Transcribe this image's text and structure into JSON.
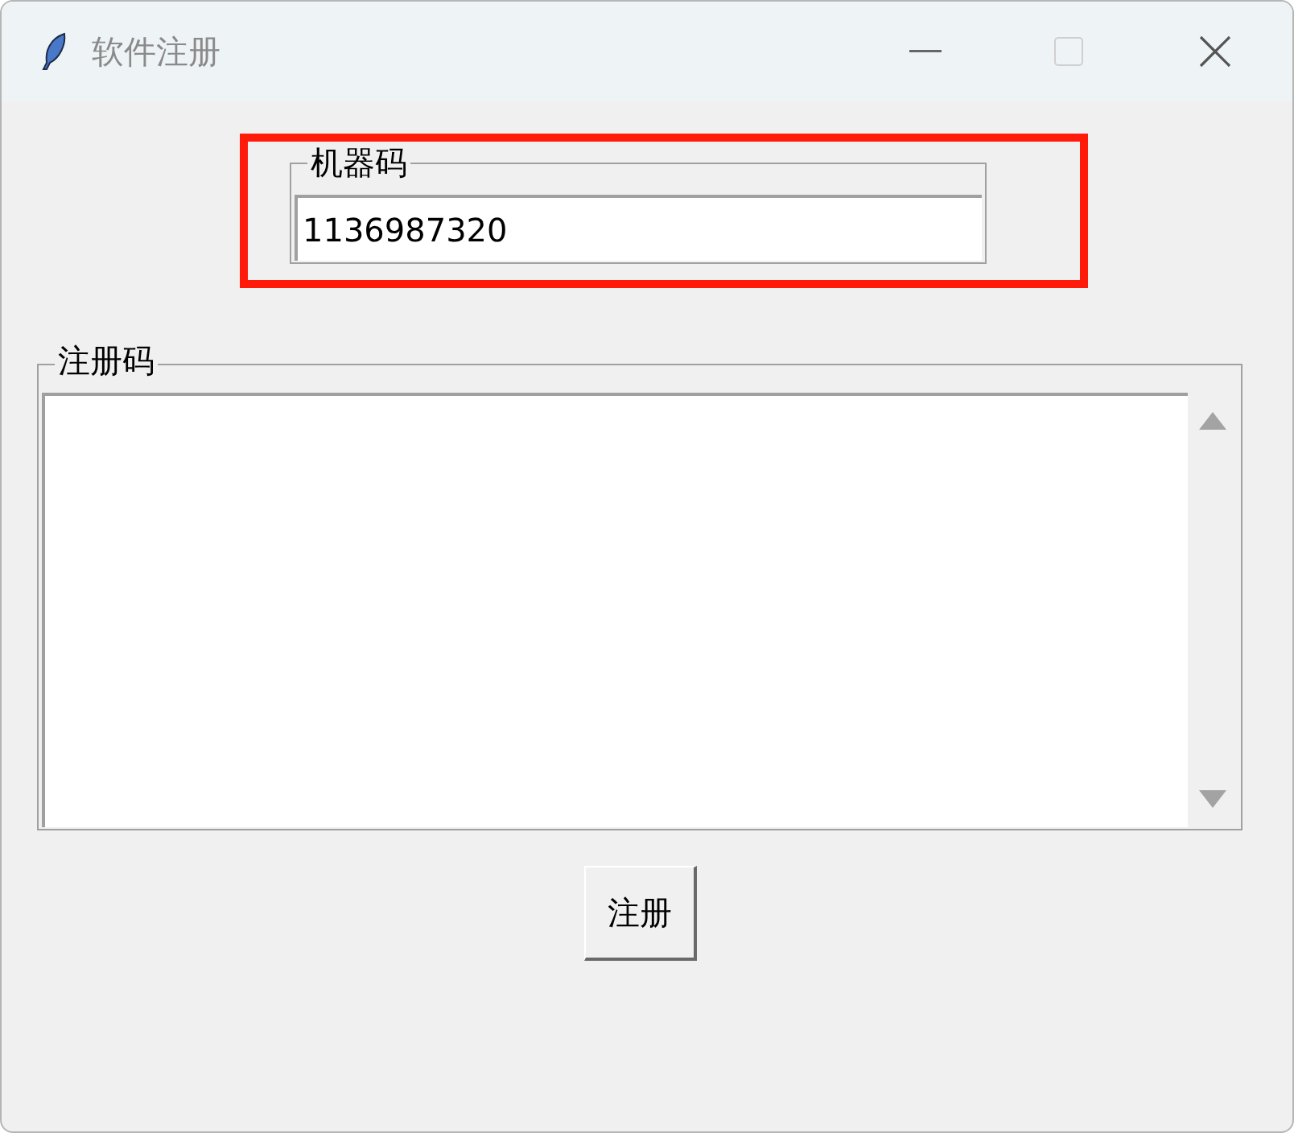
{
  "window": {
    "title": "软件注册"
  },
  "machine_code": {
    "label": "机器码",
    "value": "1136987320",
    "highlighted": true
  },
  "registration_code": {
    "label": "注册码"
  },
  "buttons": [
    {
      "label": "注册"
    }
  ]
}
